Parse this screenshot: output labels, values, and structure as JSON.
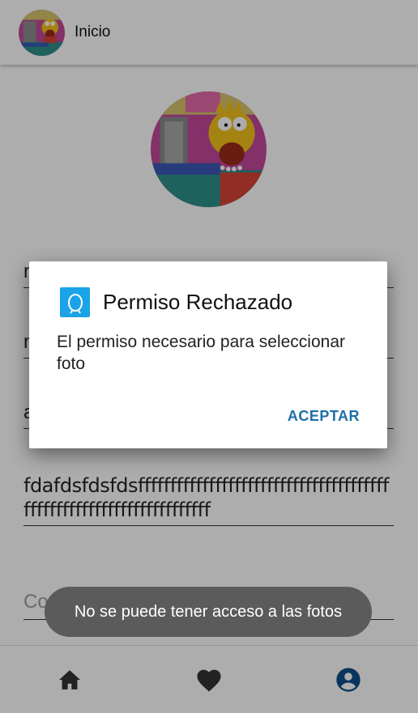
{
  "appbar": {
    "title": "Inicio"
  },
  "form": {
    "field_1_value": "n",
    "field_2_value": "n",
    "field_3_value": "a",
    "long_field_value": "fdafdsfdsfdsffffffffffffffffffffffffffffffffffffffffffffffffffffffffffffffffffff",
    "comment_placeholder": "Comentario"
  },
  "dialog": {
    "title": "Permiso Rechazado",
    "message": "El permiso necesario para seleccionar foto",
    "button": "ACEPTAR"
  },
  "toast": {
    "text": "No se puede tener acceso a las fotos"
  },
  "bottom_nav": {
    "items": [
      {
        "icon": "home-icon",
        "active": false
      },
      {
        "icon": "heart-icon",
        "active": false
      },
      {
        "icon": "account-circle-icon",
        "active": true
      }
    ]
  },
  "colors": {
    "accent": "#1e6fa8",
    "active_nav": "#0d4f8a",
    "toast_bg": "#5b5b5b",
    "dialog_icon_bg": "#1aa3e8"
  }
}
